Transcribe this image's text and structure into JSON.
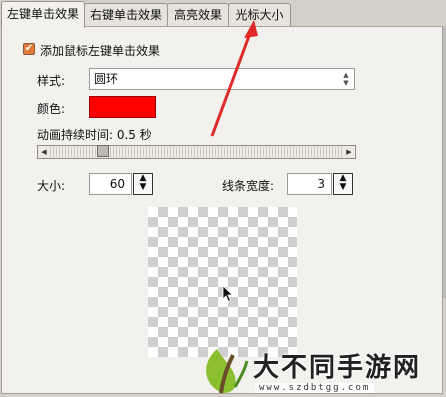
{
  "tabs": [
    {
      "label": "左键单击效果",
      "active": true
    },
    {
      "label": "右键单击效果",
      "active": false
    },
    {
      "label": "高亮效果",
      "active": false
    },
    {
      "label": "光标大小",
      "active": false
    }
  ],
  "enable_checkbox": {
    "label": "添加鼠标左键单击效果",
    "checked": true
  },
  "style": {
    "label": "样式:",
    "value": "圆环"
  },
  "color": {
    "label": "颜色:",
    "value": "#ff0000"
  },
  "duration": {
    "label": "动画持续时间: 0.5 秒"
  },
  "size": {
    "label": "大小:",
    "value": "60"
  },
  "line_width": {
    "label": "线条宽度:",
    "value": "3"
  },
  "watermark": {
    "title": "大不同手游网",
    "url": "www.szdbtgg.com"
  },
  "colors": {
    "accent_checkbox": "#e07a3d",
    "annotation_arrow": "#e02a2a"
  }
}
